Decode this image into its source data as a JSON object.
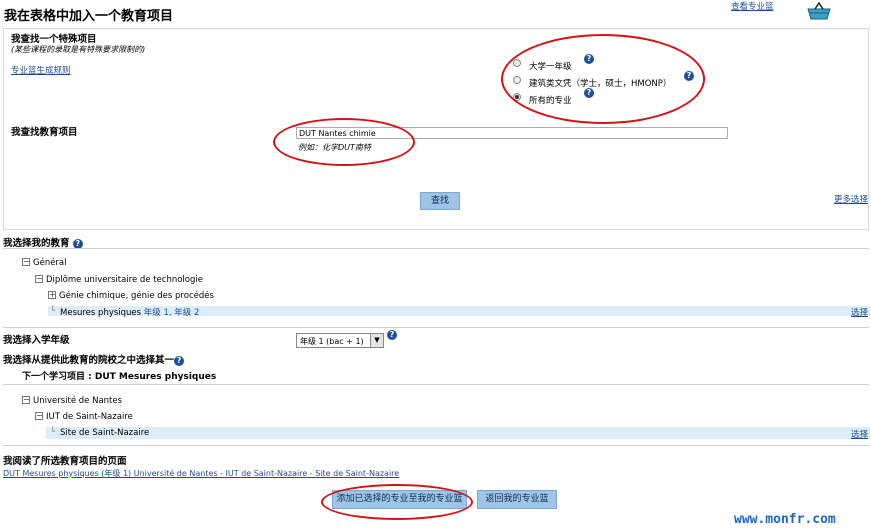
{
  "header": {
    "title": "我在表格中加入一个教育项目",
    "view_basket": "查看专业篮"
  },
  "special": {
    "heading": "我查找一个特殊项目",
    "note": "(某些课程的录取是有特殊要求限制的)",
    "rules_link": "专业篮生成规则",
    "options": [
      {
        "label": "大学一年级",
        "selected": false
      },
      {
        "label": "建筑类文凭（学士，硕士，HMONP）",
        "selected": false
      },
      {
        "label": "所有的专业",
        "selected": true
      }
    ]
  },
  "search": {
    "heading": "我查找教育项目",
    "value": "DUT Nantes chimie",
    "example": "例如：化学DUT南特",
    "button": "查找",
    "more": "更多选择"
  },
  "education": {
    "heading": "我选择我的教育",
    "tree": [
      {
        "label": "Général"
      },
      {
        "label": "Diplôme universitaire de technologie"
      },
      {
        "label": "Génie chimique, génie des procédés"
      },
      {
        "label": "Mesures physiques",
        "years": "年级 1, 年级 2"
      }
    ],
    "select": "选择"
  },
  "year": {
    "heading": "我选择入学年级",
    "value": "年级 1 (bac + 1)"
  },
  "school": {
    "heading": "我选择从提供此教育的院校之中选择其一",
    "next": "下一个学习项目 : DUT Mesures physiques",
    "tree": [
      {
        "label": "Université de Nantes"
      },
      {
        "label": "IUT de Saint-Nazaire"
      },
      {
        "label": "Site de Saint-Nazaire"
      }
    ],
    "select": "选择"
  },
  "read": {
    "heading": "我阅读了所选教育项目的页面",
    "link": "DUT Mesures physiques (年级 1) Université de Nantes - IUT de Saint-Nazaire - Site de Saint-Nazaire"
  },
  "actions": {
    "add": "添加已选择的专业至我的专业篮",
    "back": "返回我的专业篮"
  },
  "watermark": "www.monfr.com",
  "colors": {
    "accent": "#1a4f8f",
    "button": "#9ec4e8",
    "highlight": "#dcecf8",
    "annotation": "#d01414"
  }
}
